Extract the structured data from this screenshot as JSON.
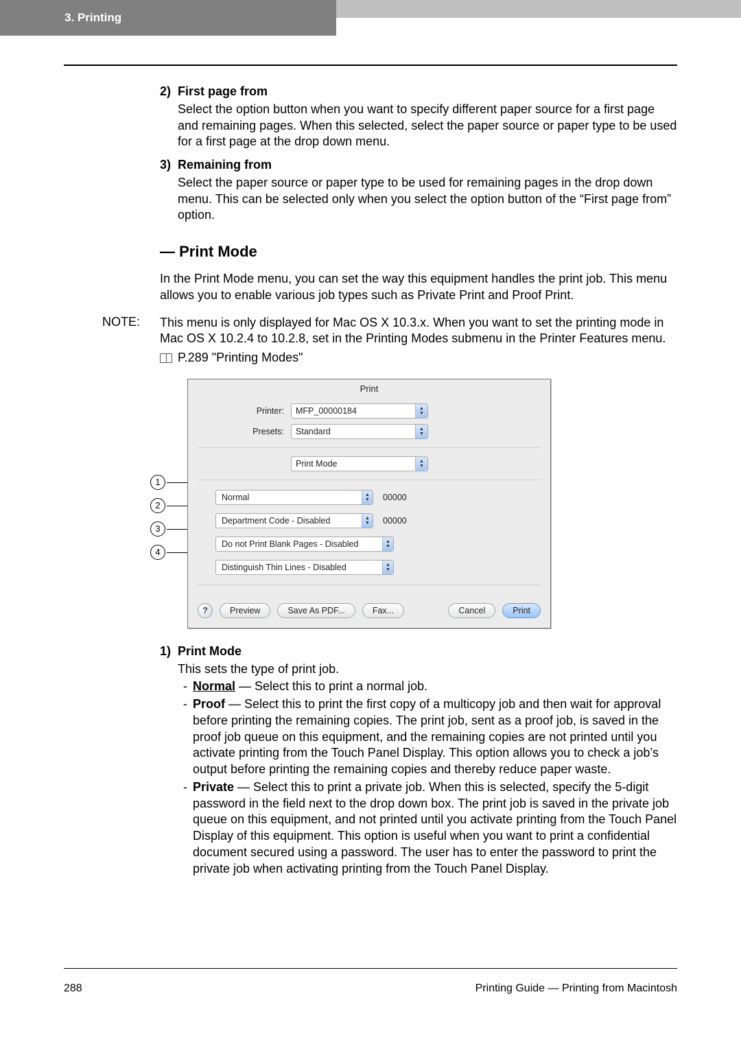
{
  "header": {
    "breadcrumb": "3. Printing"
  },
  "item2": {
    "num": "2)",
    "title": "First page from",
    "body": "Select the option button when you want to specify different paper source for a first page and remaining pages.  When this selected, select the paper source or paper type to be used for a first page at the drop down menu."
  },
  "item3": {
    "num": "3)",
    "title": "Remaining from",
    "body": "Select the paper source or paper type to be used for remaining pages in the drop down menu.  This can be selected only when you select the option button of the “First page from” option."
  },
  "section": {
    "heading": "— Print Mode",
    "intro": "In the Print Mode menu, you can set the way this equipment handles the print job.  This menu allows you to enable various job types such as Private Print and Proof Print."
  },
  "note": {
    "label": "NOTE:",
    "body": "This menu is only displayed for Mac OS X 10.3.x.  When you want to set the printing mode in Mac OS X 10.2.4 to 10.2.8, set in the Printing Modes submenu in the Printer Features menu.",
    "ref": "P.289 \"Printing Modes\""
  },
  "dialog": {
    "title": "Print",
    "printer_label": "Printer:",
    "printer_value": "MFP_00000184",
    "presets_label": "Presets:",
    "presets_value": "Standard",
    "pane_value": "Print Mode",
    "rows": {
      "r1": {
        "select": "Normal",
        "value": "00000"
      },
      "r2": {
        "select": "Department Code - Disabled",
        "value": "00000"
      },
      "r3": {
        "select": "Do not Print Blank Pages - Disabled"
      },
      "r4": {
        "select": "Distinguish Thin Lines - Disabled"
      }
    },
    "buttons": {
      "help": "?",
      "preview": "Preview",
      "savepdf": "Save As PDF...",
      "fax": "Fax...",
      "cancel": "Cancel",
      "print": "Print"
    }
  },
  "callouts": {
    "c1": "1",
    "c2": "2",
    "c3": "3",
    "c4": "4"
  },
  "lower": {
    "num": "1)",
    "title": "Print Mode",
    "lead": "This sets the type of print job.",
    "normal_term": "Normal",
    "normal_body": " — Select this to print a normal job.",
    "proof_term": "Proof",
    "proof_body": " — Select this to print the first copy of a multicopy job and then wait for approval before printing the remaining copies.  The print job, sent as a proof job, is saved in the proof job queue on this equipment, and the remaining copies are not printed until you activate printing from the Touch Panel Display.  This option allows you to check a job’s output before printing the remaining copies and thereby reduce paper waste.",
    "private_term": "Private",
    "private_body": " — Select this to print a private job.   When this is selected, specify the 5-digit password in the field next to the drop down box.  The print job is saved in the private job queue on this equipment, and not printed until you activate printing from the Touch Panel Display of this equipment.  This option is useful when you want to print a confidential document secured using a password.  The user has to enter the password to print the private job when activating printing from the Touch Panel Display."
  },
  "footer": {
    "page": "288",
    "right": "Printing Guide — Printing from Macintosh"
  }
}
